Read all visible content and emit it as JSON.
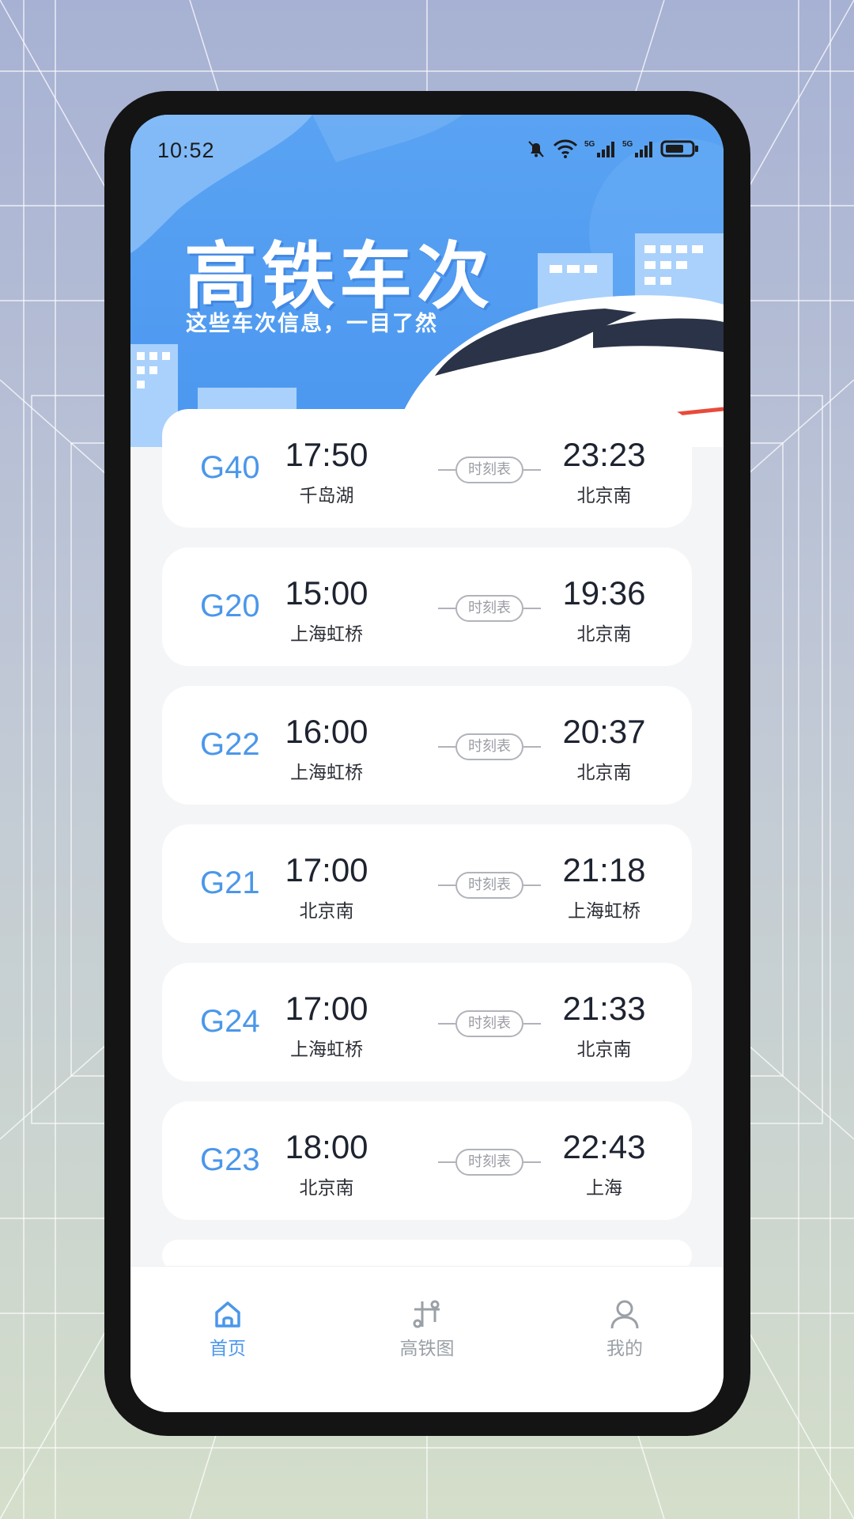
{
  "status_bar": {
    "time": "10:52",
    "icons": [
      "mute-bell-icon",
      "wifi-icon",
      "5g-signal-icon",
      "5g-signal-icon",
      "battery-icon"
    ]
  },
  "hero": {
    "title": "高铁车次",
    "subtitle": "这些车次信息，一目了然"
  },
  "trains": [
    {
      "no": "G40",
      "dep_time": "17:50",
      "dep_station": "千岛湖",
      "arr_time": "23:23",
      "arr_station": "北京南",
      "timetable_label": "时刻表"
    },
    {
      "no": "G20",
      "dep_time": "15:00",
      "dep_station": "上海虹桥",
      "arr_time": "19:36",
      "arr_station": "北京南",
      "timetable_label": "时刻表"
    },
    {
      "no": "G22",
      "dep_time": "16:00",
      "dep_station": "上海虹桥",
      "arr_time": "20:37",
      "arr_station": "北京南",
      "timetable_label": "时刻表"
    },
    {
      "no": "G21",
      "dep_time": "17:00",
      "dep_station": "北京南",
      "arr_time": "21:18",
      "arr_station": "上海虹桥",
      "timetable_label": "时刻表"
    },
    {
      "no": "G24",
      "dep_time": "17:00",
      "dep_station": "上海虹桥",
      "arr_time": "21:33",
      "arr_station": "北京南",
      "timetable_label": "时刻表"
    },
    {
      "no": "G23",
      "dep_time": "18:00",
      "dep_station": "北京南",
      "arr_time": "22:43",
      "arr_station": "上海",
      "timetable_label": "时刻表"
    }
  ],
  "tabbar": {
    "tabs": [
      {
        "label": "首页",
        "icon": "home-icon",
        "active": true
      },
      {
        "label": "高铁图",
        "icon": "rail-map-icon",
        "active": false
      },
      {
        "label": "我的",
        "icon": "profile-icon",
        "active": false
      }
    ]
  },
  "colors": {
    "accent": "#4b97ea",
    "hero_blue": "#4b97f0",
    "inactive_tab": "#9aa0a6"
  }
}
